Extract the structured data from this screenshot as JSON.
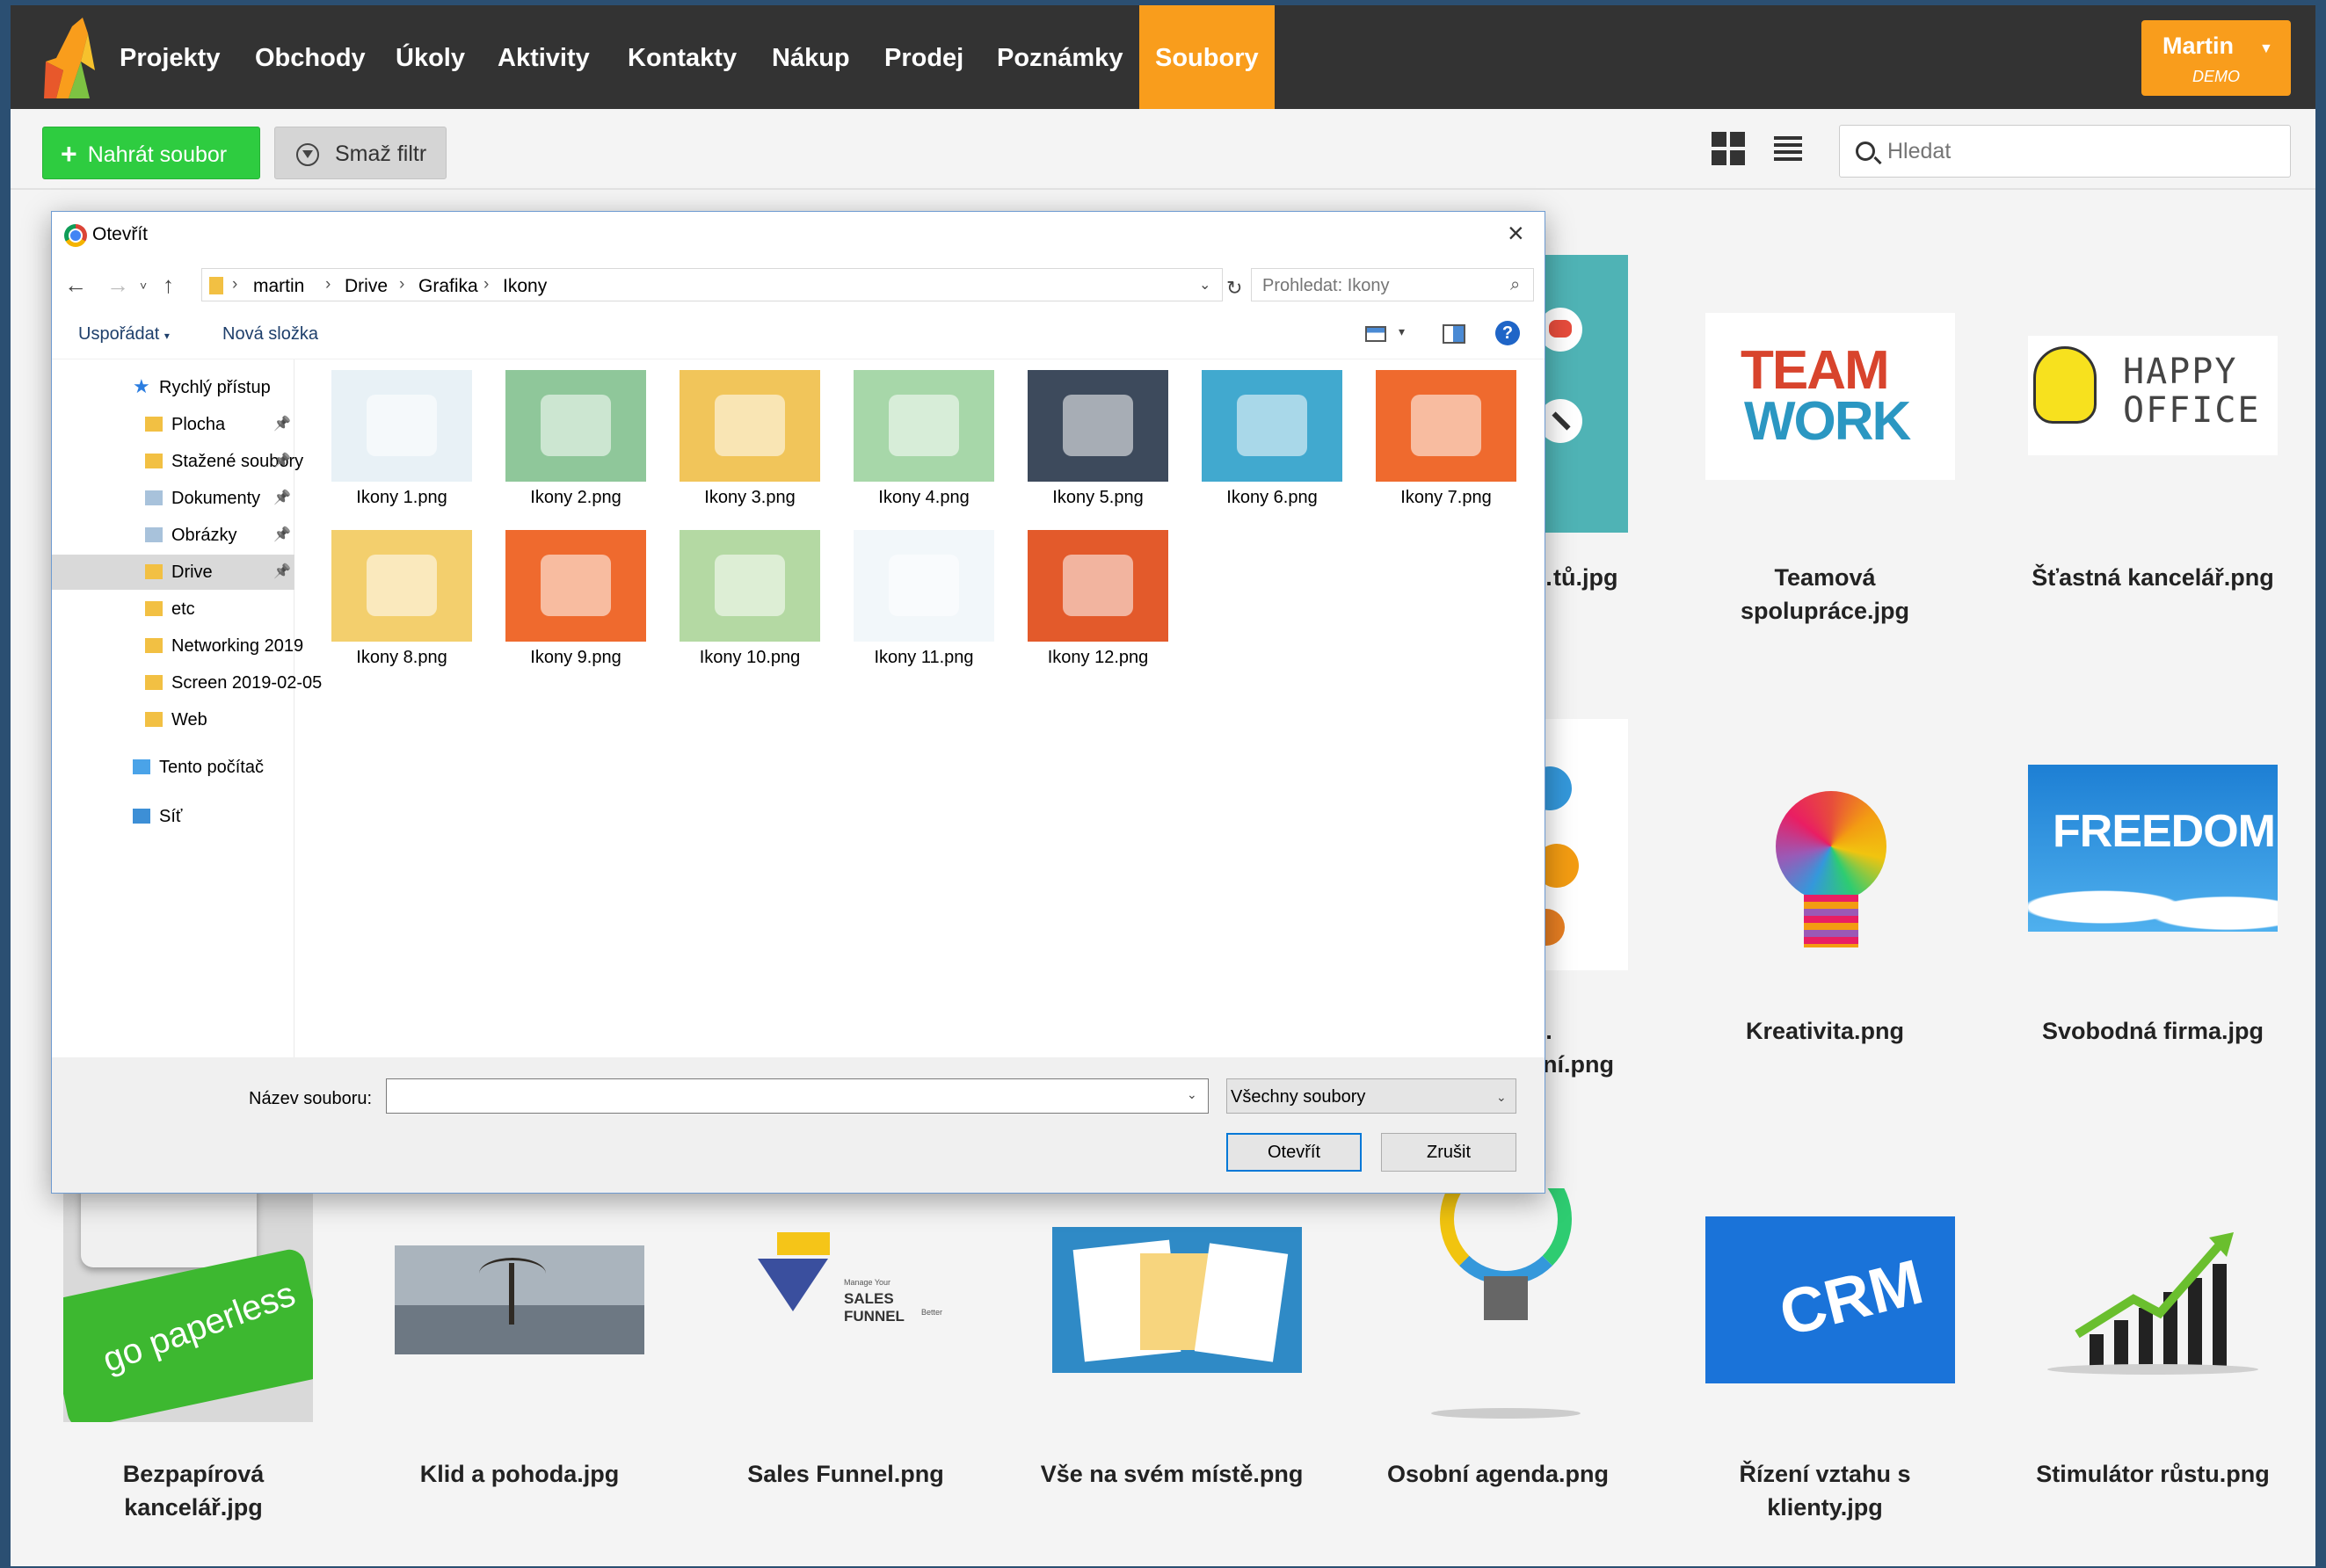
{
  "nav": {
    "items": [
      {
        "label": "Projekty"
      },
      {
        "label": "Obchody"
      },
      {
        "label": "Úkoly"
      },
      {
        "label": "Aktivity"
      },
      {
        "label": "Kontakty"
      },
      {
        "label": "Nákup"
      },
      {
        "label": "Prodej"
      },
      {
        "label": "Poznámky"
      },
      {
        "label": "Soubory",
        "active": true
      }
    ],
    "user": {
      "name": "Martin",
      "role": "DEMO"
    }
  },
  "toolbar": {
    "upload_label": "Nahrát soubor",
    "clear_filter_label": "Smaž filtr",
    "search_placeholder": "Hledat"
  },
  "gallery": {
    "captions": {
      "c1": "…tů.jpg",
      "c2": "Teamová spolupráce.jpg",
      "c3": "Šťastná kancelář.png",
      "c4": "…ení.png",
      "c5": "Kreativita.png",
      "c6": "Svobodná firma.jpg",
      "c7": "Bezpapírová kancelář.jpg",
      "c8": "Klid a pohoda.jpg",
      "c9": "Sales Funnel.png",
      "c10": "Vše na svém místě.png",
      "c11": "Osobní agenda.png",
      "c12": "Řízení vztahu s klienty.jpg",
      "c13": "Stimulátor růstu.png"
    },
    "image_text": {
      "team": "TEAM",
      "work": "WORK",
      "happy": "HAPPY",
      "office": "OFFICE",
      "freedom": "FREEDOM",
      "paperless": "go paperless",
      "crm": "CRM",
      "funnel_small": "Manage Your",
      "funnel": "SALES FUNNEL",
      "funnel_tail": "Better"
    }
  },
  "dialog": {
    "title": "Otevřít",
    "breadcrumb": [
      "martin",
      "Drive",
      "Grafika",
      "Ikony"
    ],
    "search_placeholder": "Prohledat: Ikony",
    "organize_label": "Uspořádat",
    "new_folder_label": "Nová složka",
    "help": "?",
    "quick_access": [
      {
        "label": "Rychlý přístup",
        "icon": "star-icon"
      },
      {
        "label": "Plocha",
        "icon": "folder-icon",
        "pinned": true
      },
      {
        "label": "Stažené soubory",
        "icon": "download-folder-icon",
        "pinned": true
      },
      {
        "label": "Dokumenty",
        "icon": "documents-folder-icon",
        "pinned": true
      },
      {
        "label": "Obrázky",
        "icon": "pictures-folder-icon",
        "pinned": true
      },
      {
        "label": "Drive",
        "icon": "folder-icon",
        "pinned": true,
        "selected": true
      },
      {
        "label": "etc",
        "icon": "folder-icon"
      },
      {
        "label": "Networking 2019",
        "icon": "folder-icon"
      },
      {
        "label": "Screen 2019-02-05",
        "icon": "folder-icon"
      },
      {
        "label": "Web",
        "icon": "folder-icon"
      },
      {
        "label": "Tento počítač",
        "icon": "computer-icon"
      },
      {
        "label": "Síť",
        "icon": "network-icon"
      }
    ],
    "files": [
      {
        "name": "Ikony 1.png",
        "color": "#e8f1f6"
      },
      {
        "name": "Ikony 2.png",
        "color": "#8fc79a"
      },
      {
        "name": "Ikony 3.png",
        "color": "#f1c55a"
      },
      {
        "name": "Ikony 4.png",
        "color": "#a7d7a9"
      },
      {
        "name": "Ikony 5.png",
        "color": "#3d4a5c"
      },
      {
        "name": "Ikony 6.png",
        "color": "#41a9cf"
      },
      {
        "name": "Ikony 7.png",
        "color": "#ef6a2e"
      },
      {
        "name": "Ikony 8.png",
        "color": "#f3cf6d"
      },
      {
        "name": "Ikony 9.png",
        "color": "#ef6a2e"
      },
      {
        "name": "Ikony 10.png",
        "color": "#b4d9a3"
      },
      {
        "name": "Ikony 11.png",
        "color": "#f2f7fa"
      },
      {
        "name": "Ikony 12.png",
        "color": "#e35a2b"
      }
    ],
    "filename_label": "Název souboru:",
    "filename_value": "",
    "filetype": "Všechny soubory",
    "open_label": "Otevřít",
    "cancel_label": "Zrušit"
  }
}
